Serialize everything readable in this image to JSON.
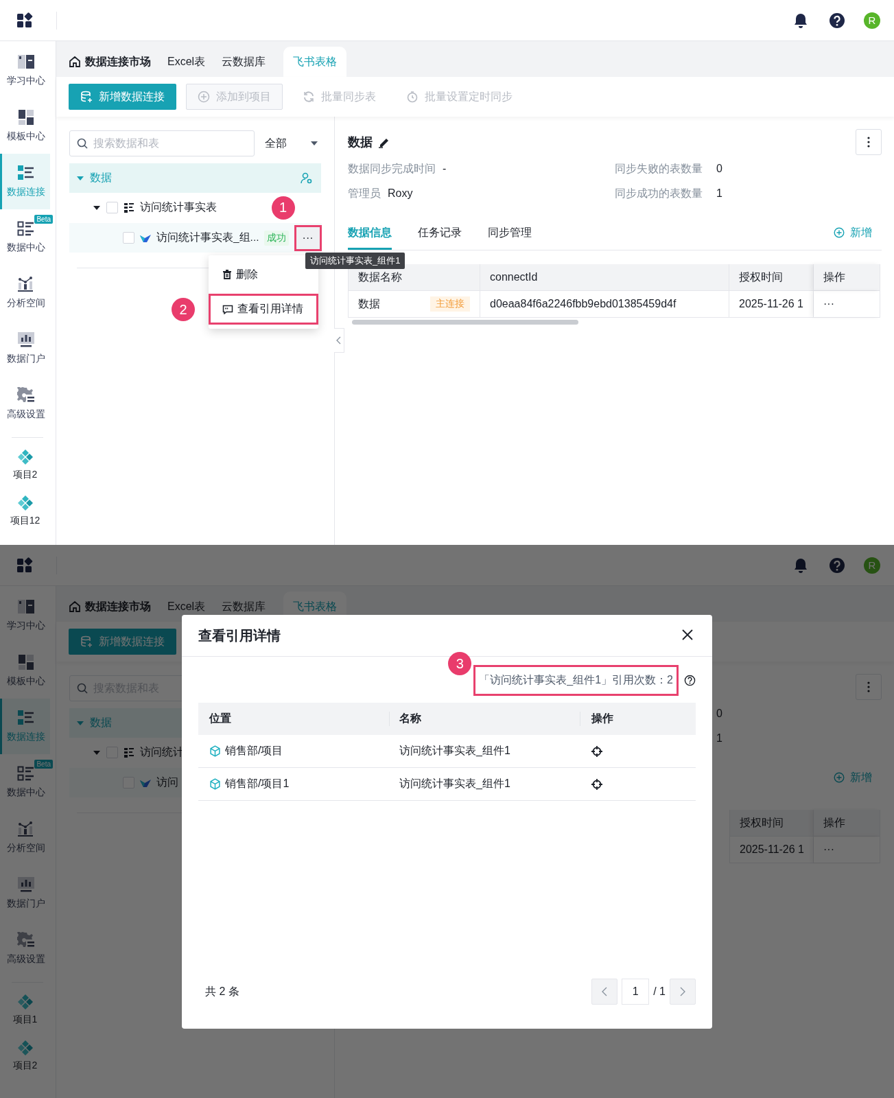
{
  "screens": [
    {
      "top_bar": {
        "avatar": "R"
      },
      "sidebar": {
        "items": [
          {
            "label": "学习中心",
            "selected": false
          },
          {
            "label": "模板中心",
            "selected": false
          },
          {
            "label": "数据连接",
            "selected": true
          },
          {
            "label": "数据中心",
            "selected": false,
            "badge": "Beta"
          },
          {
            "label": "分析空间",
            "selected": false
          },
          {
            "label": "数据门户",
            "selected": false
          },
          {
            "label": "高级设置",
            "selected": false
          }
        ],
        "projects": [
          "项目2",
          "项目12"
        ]
      },
      "tabs": [
        {
          "label": "数据连接市场",
          "kind": "home",
          "selected": false
        },
        {
          "label": "Excel表",
          "kind": "plain",
          "selected": false
        },
        {
          "label": "云数据库",
          "kind": "plain",
          "selected": false
        },
        {
          "label": "飞书表格",
          "kind": "plain",
          "selected": true
        }
      ],
      "toolbar": [
        {
          "label": "新增数据连接",
          "kind": "primary",
          "disabled": false
        },
        {
          "label": "添加到项目",
          "kind": "outline",
          "disabled": true
        },
        {
          "label": "批量同步表",
          "kind": "text",
          "disabled": true
        },
        {
          "label": "批量设置定时同步",
          "kind": "text",
          "disabled": true
        }
      ],
      "search": {
        "placeholder": "搜索数据和表"
      },
      "filter": {
        "value": "全部"
      },
      "tree": [
        {
          "label": "数据",
          "selected": true,
          "expanded": true,
          "children": [
            {
              "label": "访问统计事实表",
              "expanded": true,
              "checked": false,
              "children": [
                {
                  "label": "访问统计事实表_组...",
                  "checked": false,
                  "status": "成功",
                  "more": "···",
                  "callout": "1"
                }
              ]
            }
          ]
        }
      ],
      "context_menu": [
        {
          "label": "删除"
        },
        {
          "label": "查看引用详情",
          "callout": "2"
        }
      ],
      "tooltip": "访问统计事实表_组件1",
      "detail": {
        "title": "数据",
        "meta_columns": [
          {
            "items": [
              {
                "label": "数据同步完成时间",
                "value": "-"
              },
              {
                "label": "管理员",
                "value": "Roxy"
              }
            ]
          },
          {
            "items": [
              {
                "label": "同步失败的表数量",
                "value": "0"
              },
              {
                "label": "同步成功的表数量",
                "value": "1"
              }
            ]
          }
        ],
        "tabs": [
          {
            "label": "数据信息",
            "selected": true
          },
          {
            "label": "任务记录",
            "selected": false
          },
          {
            "label": "同步管理",
            "selected": false
          }
        ],
        "add_link": "新增",
        "table": {
          "columns": [
            {
              "label": "数据名称",
              "kind": "name"
            },
            {
              "label": "connectId",
              "kind": "id"
            },
            {
              "label": "授权时间",
              "kind": "time"
            },
            {
              "label": "操作",
              "kind": "action"
            }
          ],
          "rows": [
            {
              "cells": [
                "数据",
                "d0eaa84f6a2246fbb9ebd01385459d4f",
                "2025-11-26 1",
                "···"
              ],
              "tag": "主连接"
            }
          ]
        }
      }
    },
    {
      "top_bar": {
        "avatar": "R"
      },
      "sidebar": {
        "items": [
          {
            "label": "学习中心",
            "selected": false
          },
          {
            "label": "模板中心",
            "selected": false
          },
          {
            "label": "数据连接",
            "selected": true
          },
          {
            "label": "数据中心",
            "selected": false,
            "badge": "Beta"
          },
          {
            "label": "分析空间",
            "selected": false
          },
          {
            "label": "数据门户",
            "selected": false
          },
          {
            "label": "高级设置",
            "selected": false
          }
        ],
        "projects": [
          "项目1",
          "项目2"
        ]
      },
      "tabs": [
        {
          "label": "数据连接市场",
          "kind": "home",
          "selected": false
        },
        {
          "label": "Excel表",
          "kind": "plain",
          "selected": false
        },
        {
          "label": "云数据库",
          "kind": "plain",
          "selected": false
        },
        {
          "label": "飞书表格",
          "kind": "plain",
          "selected": true
        }
      ],
      "toolbar": [
        {
          "label": "新增数据连接",
          "kind": "primary",
          "disabled": false
        }
      ],
      "search": {
        "placeholder": "搜索数据和表"
      },
      "tree": [
        {
          "label": "数据",
          "selected": true,
          "expanded": true,
          "children": [
            {
              "label": "访问统计",
              "expanded": true,
              "checked": false,
              "children": [
                {
                  "label": "访问",
                  "checked": false
                }
              ]
            }
          ]
        }
      ],
      "detail": {
        "meta_columns": [
          {
            "items": [
              {
                "value": "0"
              },
              {
                "value": "1"
              }
            ]
          }
        ],
        "add_link": "新增",
        "table": {
          "columns": [
            {
              "label": "授权时间",
              "kind": "time"
            },
            {
              "label": "操作",
              "kind": "action"
            }
          ],
          "rows": [
            {
              "cells": [
                "2025-11-26 1",
                "···"
              ]
            }
          ]
        }
      },
      "modal": {
        "title": "查看引用详情",
        "count_text": "「访问统计事实表_组件1」引用次数：2",
        "callout": "3",
        "columns": [
          "位置",
          "名称",
          "操作"
        ],
        "rows": [
          {
            "location": "销售部/项目",
            "name": "访问统计事实表_组件1"
          },
          {
            "location": "销售部/项目1",
            "name": "访问统计事实表_组件1"
          }
        ],
        "total": "共 2 条",
        "page": "1",
        "page_count": "/ 1"
      }
    }
  ]
}
